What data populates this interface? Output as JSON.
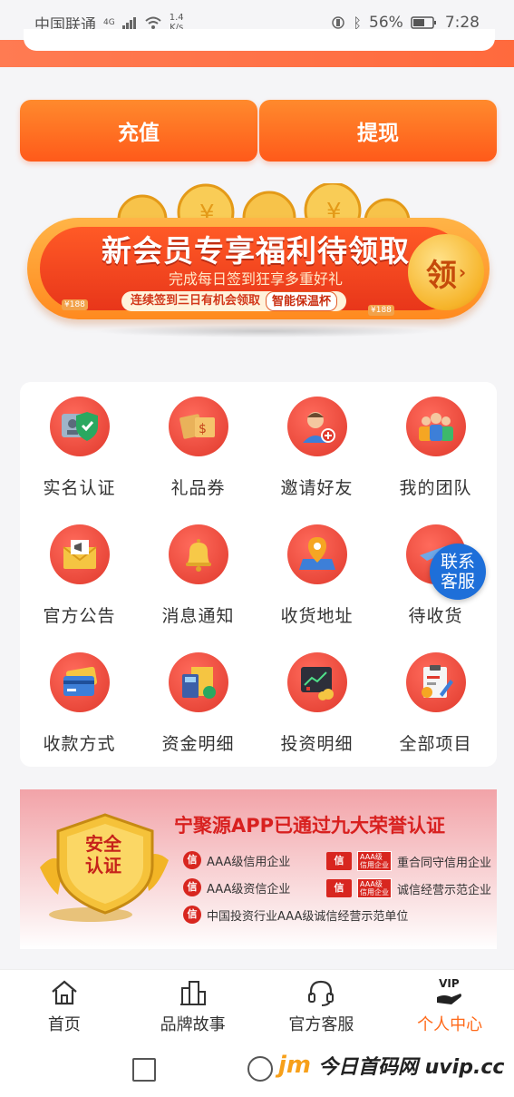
{
  "status_bar": {
    "carrier": "中国联通",
    "signal_type": "4G",
    "net_speed_value": "1.4",
    "net_speed_unit": "K/s",
    "battery": "56%",
    "time": "7:28"
  },
  "actions": {
    "recharge": "充值",
    "withdraw": "提现"
  },
  "promo_banner": {
    "title": "新会员专享福利待领取",
    "subtitle": "完成每日签到狂享多重好礼",
    "tagline": "连续签到三日有机会领取",
    "highlight": "智能保温杯",
    "claim": "领",
    "price_tag": "¥188"
  },
  "grid": {
    "items": [
      {
        "label": "实名认证",
        "icon": "id-card-icon"
      },
      {
        "label": "礼品券",
        "icon": "gift-voucher-icon"
      },
      {
        "label": "邀请好友",
        "icon": "invite-friend-icon"
      },
      {
        "label": "我的团队",
        "icon": "team-icon"
      },
      {
        "label": "官方公告",
        "icon": "announcement-icon"
      },
      {
        "label": "消息通知",
        "icon": "bell-icon"
      },
      {
        "label": "收货地址",
        "icon": "location-icon"
      },
      {
        "label": "待收货",
        "icon": "delivery-icon"
      },
      {
        "label": "收款方式",
        "icon": "bank-card-icon"
      },
      {
        "label": "资金明细",
        "icon": "fund-detail-icon"
      },
      {
        "label": "投资明细",
        "icon": "investment-icon"
      },
      {
        "label": "全部项目",
        "icon": "all-projects-icon"
      }
    ]
  },
  "floating_support": {
    "line1": "联系",
    "line2": "客服"
  },
  "honor": {
    "badge_line1": "安全",
    "badge_line2": "认证",
    "headline": "宁聚源APP已通过九大荣誉认证",
    "items": [
      "AAA级信用企业",
      "重合同守信用企业",
      "AAA级资信企业",
      "诚信经营示范企业",
      "中国投资行业AAA级诚信经营示范单位"
    ],
    "small_seal": "信",
    "small_label": "AAA级",
    "small_label_2": "信用企业"
  },
  "tabbar": {
    "tabs": [
      {
        "label": "首页",
        "icon": "home-icon",
        "active": false
      },
      {
        "label": "品牌故事",
        "icon": "building-icon",
        "active": false
      },
      {
        "label": "官方客服",
        "icon": "headset-icon",
        "active": false
      },
      {
        "label": "个人中心",
        "icon": "vip-hand-icon",
        "active": true
      }
    ],
    "vip_text": "VIP"
  },
  "watermark": {
    "logo": "jm",
    "text": "今日首码网 uvip.cc"
  },
  "colors": {
    "accent": "#ff6a1a",
    "icon_bg": "#e0392c",
    "support_bubble": "#1e6fd9",
    "honor_red": "#d8201f"
  }
}
